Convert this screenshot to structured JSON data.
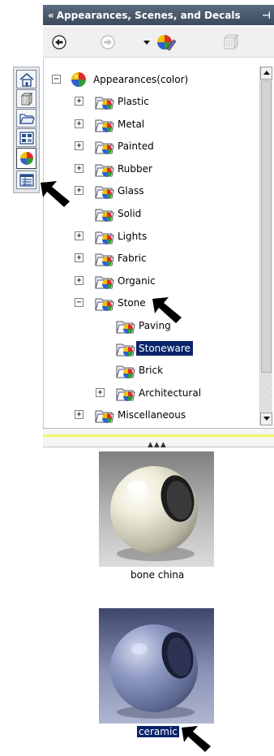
{
  "title": "Appearances, Scenes, and Decals",
  "tree": {
    "root": "Appearances(color)",
    "items": [
      {
        "label": "Plastic",
        "expander": "+"
      },
      {
        "label": "Metal",
        "expander": "+"
      },
      {
        "label": "Painted",
        "expander": "+"
      },
      {
        "label": "Rubber",
        "expander": "+"
      },
      {
        "label": "Glass",
        "expander": "+"
      },
      {
        "label": "Solid",
        "expander": ""
      },
      {
        "label": "Lights",
        "expander": "+"
      },
      {
        "label": "Fabric",
        "expander": "+"
      },
      {
        "label": "Organic",
        "expander": "+"
      },
      {
        "label": "Stone",
        "expander": "−"
      }
    ],
    "stone_children": [
      {
        "label": "Paving",
        "expander": ""
      },
      {
        "label": "Stoneware",
        "expander": "",
        "selected": true
      },
      {
        "label": "Brick",
        "expander": ""
      },
      {
        "label": "Architectural",
        "expander": "+"
      }
    ],
    "last": {
      "label": "Miscellaneous",
      "expander": "+"
    },
    "root_expander": "−"
  },
  "preview": {
    "items": [
      {
        "caption": "bone china",
        "selected": false
      },
      {
        "caption": "ceramic",
        "selected": true
      }
    ]
  },
  "icons": {
    "title_left": "«",
    "title_right": "⊣",
    "toolbar": [
      "back-icon",
      "forward-icon",
      "dropdown-icon",
      "appearance-icon",
      "copy-icon"
    ],
    "tabs": [
      "home-icon",
      "3d-content-icon",
      "folder-icon",
      "view-palette-icon",
      "appearances-icon",
      "properties-icon"
    ]
  },
  "colors": {
    "selection": "#0a246a",
    "title_bg": "#4a596c",
    "splitter_line": "#f4f46a"
  }
}
